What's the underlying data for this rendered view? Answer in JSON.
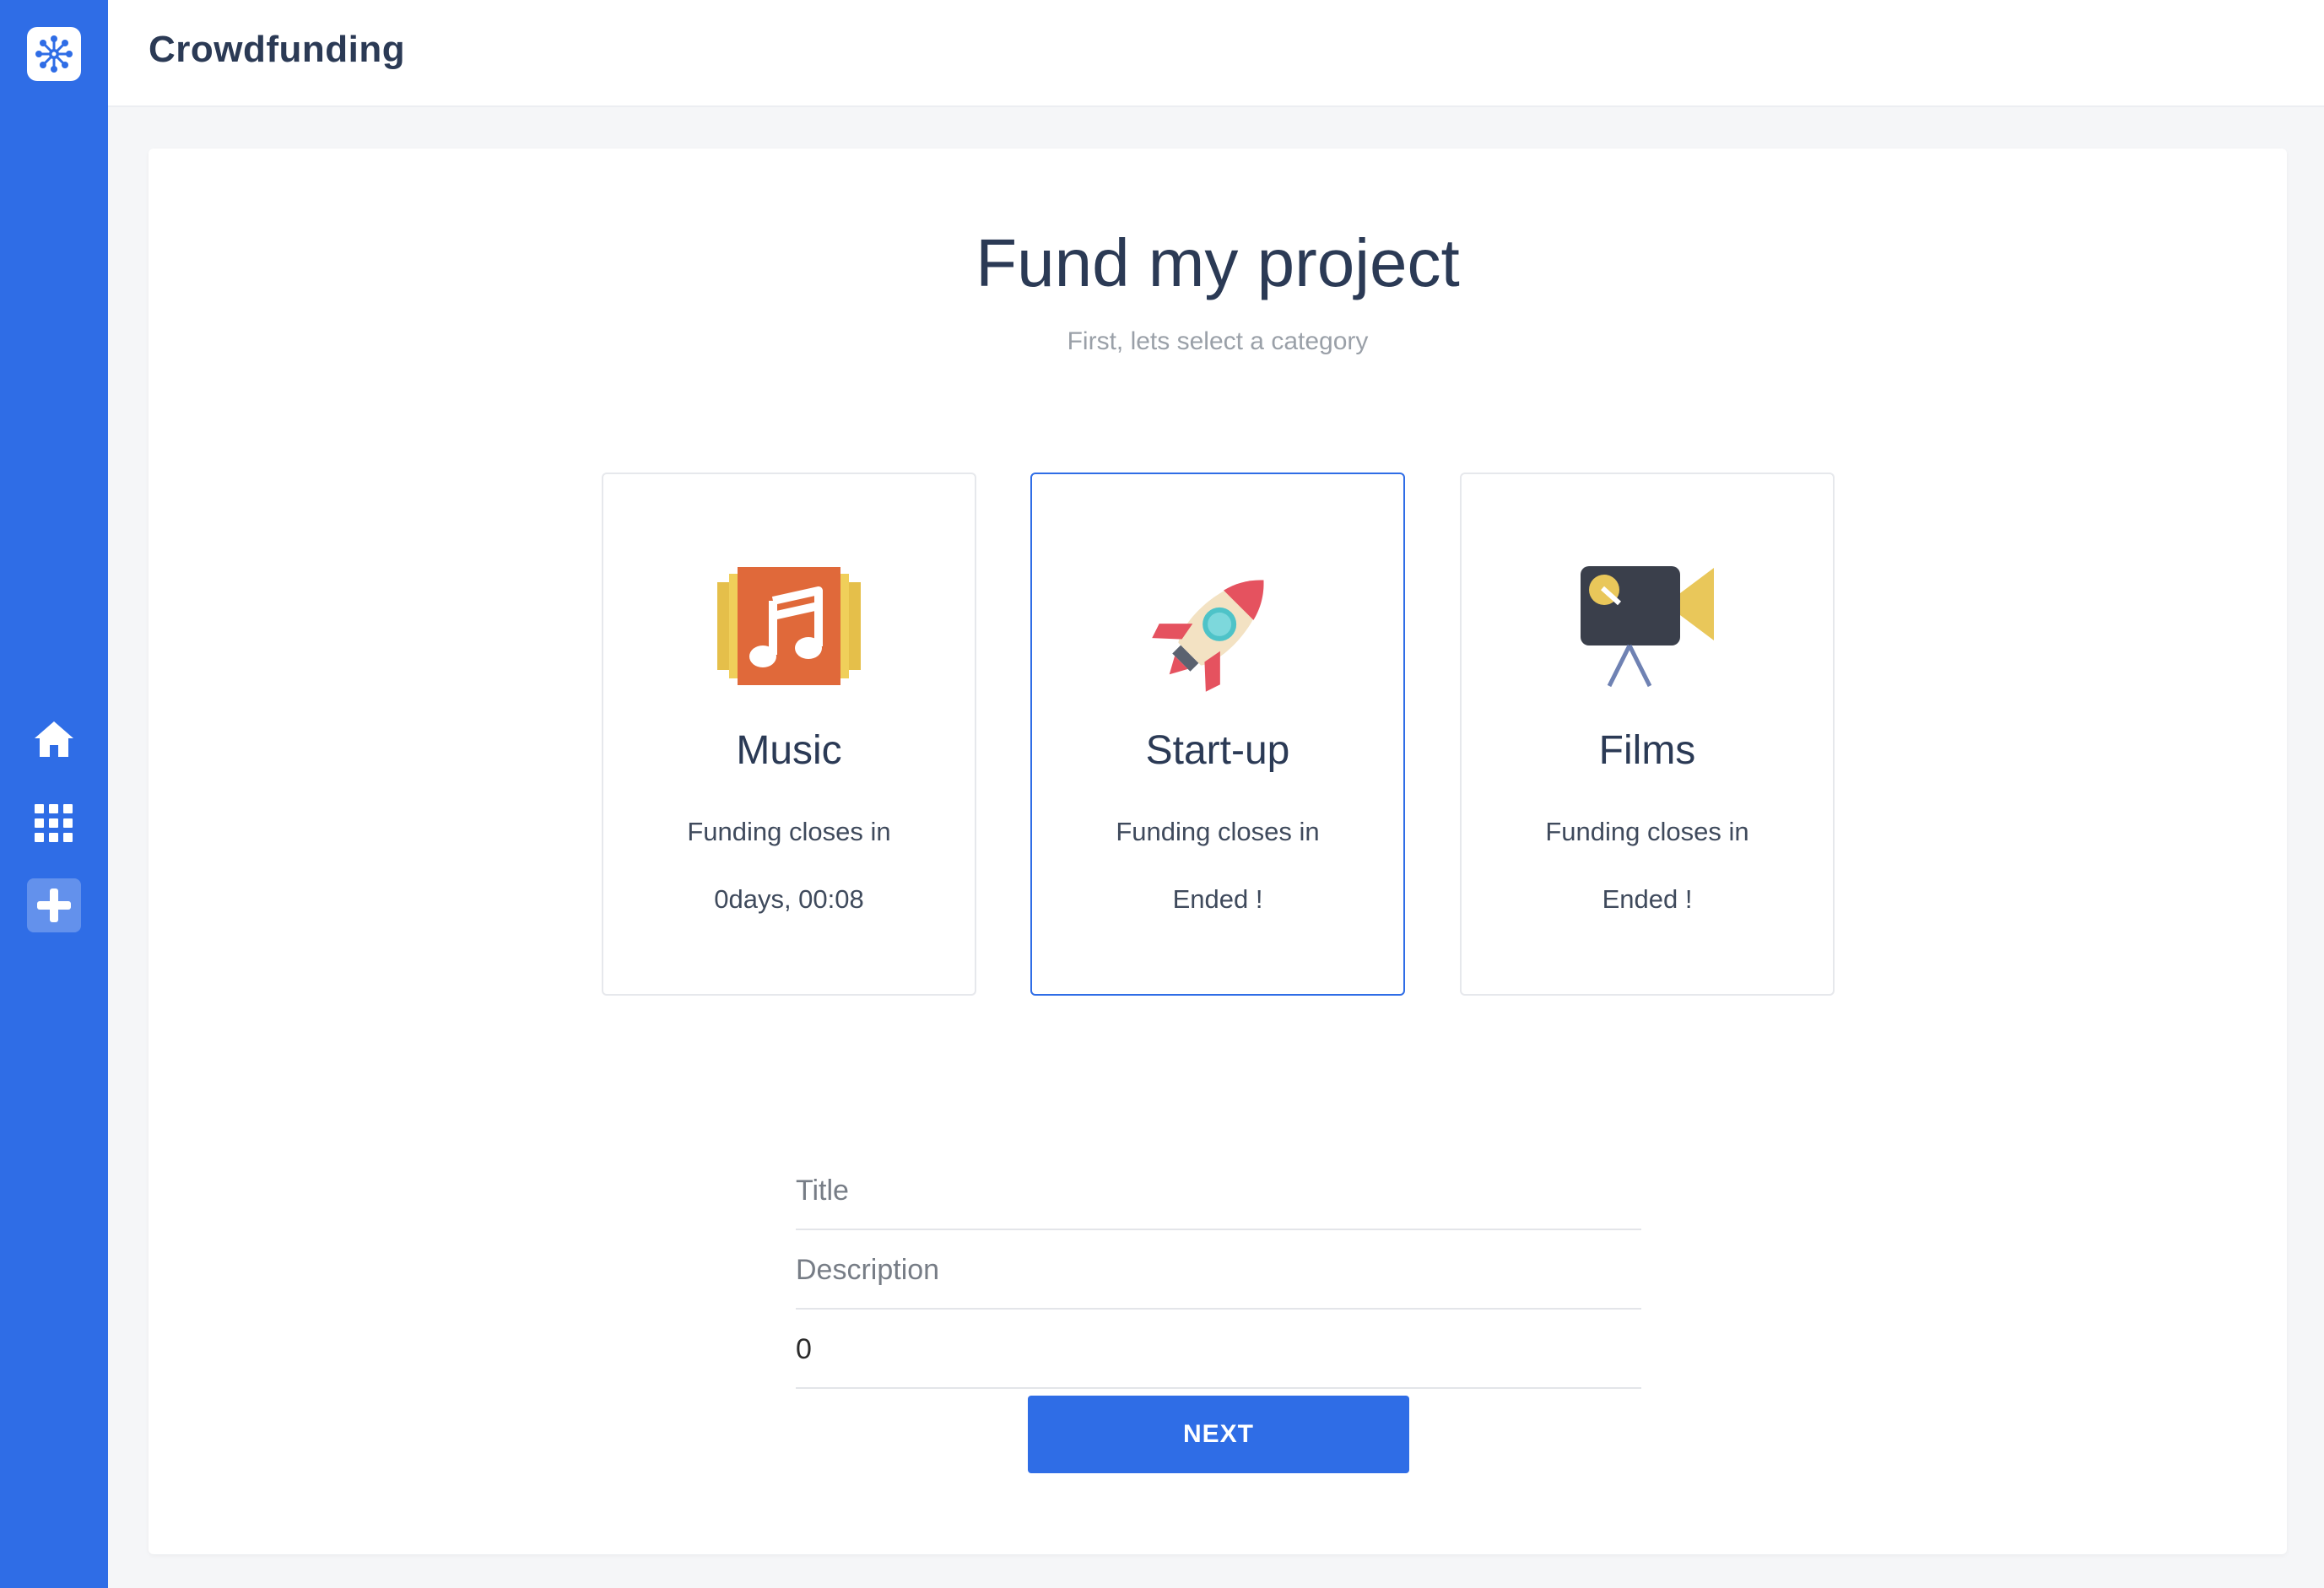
{
  "app": {
    "title": "Crowdfunding",
    "accent_color": "#2f6de6",
    "logo_icon": "network-logo-icon"
  },
  "sidebar": {
    "items": [
      {
        "icon": "home-icon",
        "label": "Home"
      },
      {
        "icon": "grid-icon",
        "label": "Projects"
      },
      {
        "icon": "plus-icon",
        "label": "Add project",
        "active": true
      }
    ]
  },
  "page": {
    "title": "Fund my project",
    "subtitle": "First, lets select a category"
  },
  "categories": [
    {
      "name": "Music",
      "icon": "music-album-icon",
      "closes_label": "Funding closes in",
      "closes_value": "0days, 00:08",
      "selected": false
    },
    {
      "name": "Start-up",
      "icon": "rocket-icon",
      "closes_label": "Funding closes in",
      "closes_value": "Ended !",
      "selected": true
    },
    {
      "name": "Films",
      "icon": "movie-camera-icon",
      "closes_label": "Funding closes in",
      "closes_value": "Ended !",
      "selected": false
    }
  ],
  "form": {
    "title_placeholder": "Title",
    "title_value": "",
    "description_placeholder": "Description",
    "description_value": "",
    "amount_value": "0"
  },
  "actions": {
    "next_label": "NEXT"
  }
}
